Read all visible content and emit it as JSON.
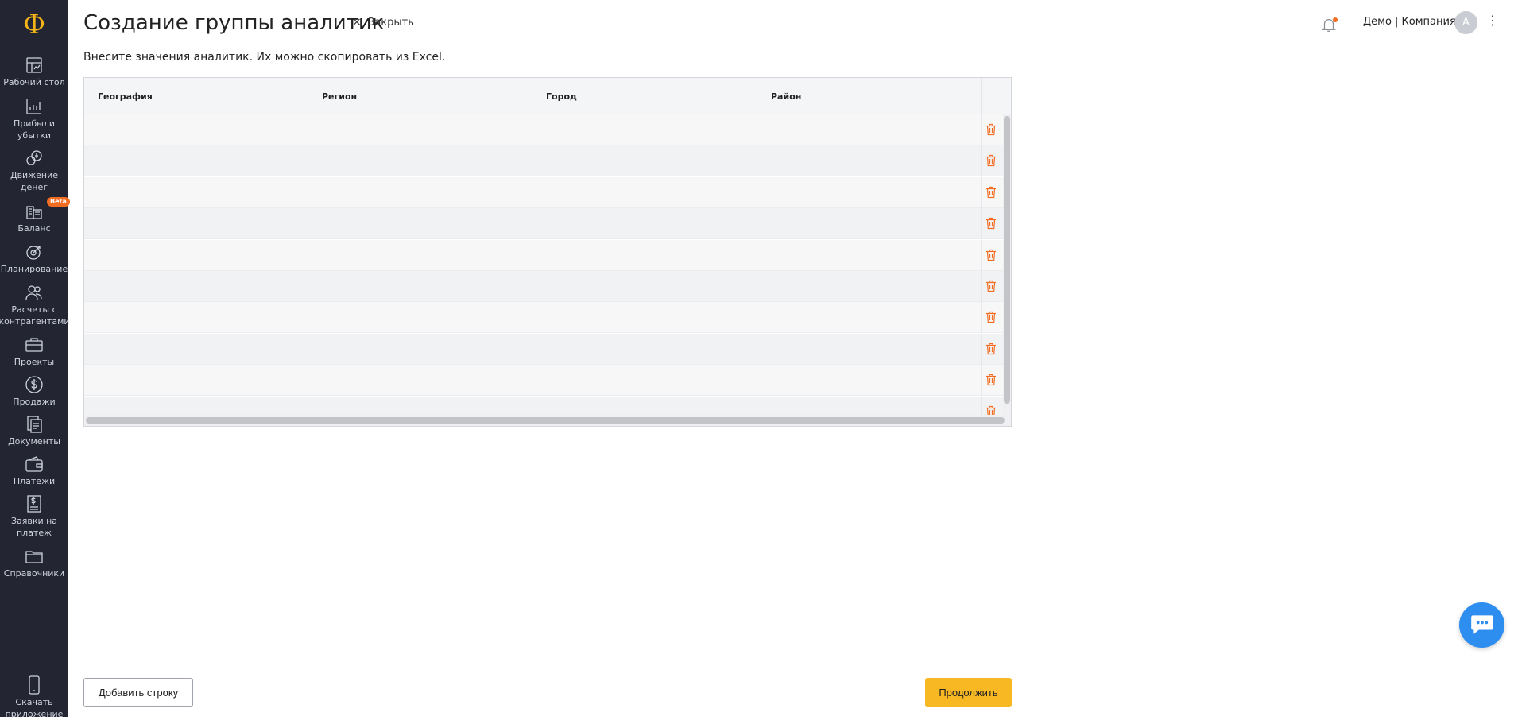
{
  "app": {
    "logo": "Ф"
  },
  "sidebar": {
    "items": [
      {
        "label": "Рабочий стол",
        "icon": "dashboard-icon"
      },
      {
        "label": "Прибыли\nубытки",
        "icon": "chart-icon"
      },
      {
        "label": "Движение\nденег",
        "icon": "coins-icon"
      },
      {
        "label": "Баланс",
        "icon": "balance-icon",
        "badge": "Beta"
      },
      {
        "label": "Планирование",
        "icon": "target-icon"
      },
      {
        "label": "Расчеты с\nконтрагентами",
        "icon": "partners-icon"
      },
      {
        "label": "Проекты",
        "icon": "briefcase-icon"
      },
      {
        "label": "Продажи",
        "icon": "dollar-icon"
      },
      {
        "label": "Документы",
        "icon": "documents-icon"
      },
      {
        "label": "Платежи",
        "icon": "wallet-icon"
      },
      {
        "label": "Заявки на\nплатеж",
        "icon": "payment-request-icon"
      },
      {
        "label": "Справочники",
        "icon": "folder-icon"
      }
    ],
    "download": {
      "label": "Скачать\nприложение",
      "icon": "phone-icon"
    }
  },
  "header": {
    "title": "Создание группы аналитик",
    "close_symbol": "×",
    "close_label": "Закрыть",
    "company": "Демо | Компания",
    "avatar_initial": "А",
    "menu_symbol": "⋮"
  },
  "subtitle": "Внесите значения аналитик. Их можно скопировать из Excel.",
  "table": {
    "columns": [
      "География",
      "Регион",
      "Город",
      "Район"
    ],
    "rows": [
      [
        "",
        "",
        "",
        ""
      ],
      [
        "",
        "",
        "",
        ""
      ],
      [
        "",
        "",
        "",
        ""
      ],
      [
        "",
        "",
        "",
        ""
      ],
      [
        "",
        "",
        "",
        ""
      ],
      [
        "",
        "",
        "",
        ""
      ],
      [
        "",
        "",
        "",
        ""
      ],
      [
        "",
        "",
        "",
        ""
      ],
      [
        "",
        "",
        "",
        ""
      ],
      [
        "",
        "",
        "",
        ""
      ]
    ]
  },
  "footer": {
    "add_row_label": "Добавить строку",
    "continue_label": "Продолжить"
  },
  "colors": {
    "sidebar_bg": "#232632",
    "accent": "#f7b824",
    "logo": "#f5b417",
    "delete_icon": "#f26c21",
    "chat_button": "#2d8ef0"
  }
}
